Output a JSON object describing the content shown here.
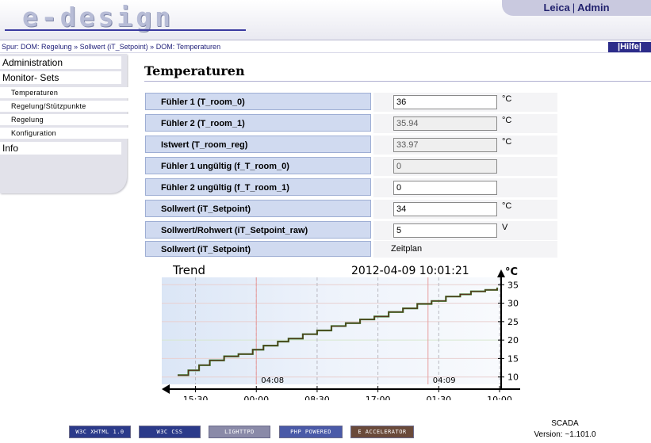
{
  "header": {
    "logo_text": "e-design",
    "user": "Leica",
    "role": "Admin"
  },
  "breadcrumb": {
    "prefix": "Spur:",
    "items": [
      "DOM: Regelung",
      "Sollwert (iT_Setpoint)",
      "DOM: Temperaturen"
    ],
    "help_label": "Hilfe"
  },
  "sidebar": {
    "items": [
      {
        "label": "Administration",
        "level": "main"
      },
      {
        "label": "Monitor- Sets",
        "level": "main"
      },
      {
        "label": "Temperaturen",
        "level": "sub"
      },
      {
        "label": "Regelung/Stützpunkte",
        "level": "sub"
      },
      {
        "label": "Regelung",
        "level": "sub"
      },
      {
        "label": "Konfiguration",
        "level": "sub"
      },
      {
        "label": "Info",
        "level": "main"
      }
    ]
  },
  "main": {
    "title": "Temperaturen",
    "rows": [
      {
        "label": "Fühler 1 (T_room_0)",
        "value": "36",
        "unit": "°C",
        "readonly": false
      },
      {
        "label": "Fühler 2 (T_room_1)",
        "value": "35.94",
        "unit": "°C",
        "readonly": true
      },
      {
        "label": "Istwert (T_room_reg)",
        "value": "33.97",
        "unit": "°C",
        "readonly": true
      },
      {
        "label": "Fühler 1 ungültig (f_T_room_0)",
        "value": "0",
        "unit": "",
        "readonly": true
      },
      {
        "label": "Fühler 2 ungültig (f_T_room_1)",
        "value": "0",
        "unit": "",
        "readonly": false
      },
      {
        "label": "Sollwert (iT_Setpoint)",
        "value": "34",
        "unit": "°C",
        "readonly": false
      },
      {
        "label": "Sollwert/Rohwert (iT_Setpoint_raw)",
        "value": "5",
        "unit": "V",
        "readonly": false
      },
      {
        "label": "Sollwert (iT_Setpoint)",
        "static_text": "Zeitplan"
      }
    ]
  },
  "chart_data": {
    "type": "line",
    "title": "Trend",
    "timestamp": "2012-04-09 10:01:21",
    "ylabel": "°C",
    "ylim": [
      8,
      37
    ],
    "yticks": [
      10,
      15,
      20,
      25,
      30,
      35
    ],
    "xticks": [
      "15:30",
      "00:00",
      "08:30",
      "17:00",
      "01:30",
      "10:00"
    ],
    "date_markers": [
      "04:08",
      "04:09"
    ],
    "series": [
      {
        "color": "#5a2a1a",
        "x": [
          "13:00",
          "14:30",
          "16:00",
          "17:30",
          "19:30",
          "21:30",
          "23:30",
          "01:00",
          "03:00",
          "04:30",
          "06:30",
          "08:30",
          "10:30",
          "12:30",
          "14:30",
          "16:30",
          "18:30",
          "20:30",
          "22:30",
          "00:30",
          "02:30",
          "04:30",
          "06:00",
          "08:00",
          "09:40"
        ],
        "values": [
          10.5,
          11.8,
          13.2,
          14.5,
          15.6,
          16.2,
          17.4,
          18.5,
          19.6,
          20.4,
          21.6,
          22.6,
          23.8,
          24.6,
          25.6,
          26.4,
          27.6,
          28.6,
          29.8,
          30.6,
          31.8,
          32.4,
          33.2,
          33.6,
          34.0
        ]
      }
    ],
    "grid": true
  },
  "footer": {
    "badges": [
      "W3C XHTML 1.0",
      "W3C CSS",
      "LIGHTTPD",
      "PHP POWERED",
      "E ACCELERATOR"
    ],
    "product": "SCADA",
    "version": "Version: ~1.101.0"
  }
}
